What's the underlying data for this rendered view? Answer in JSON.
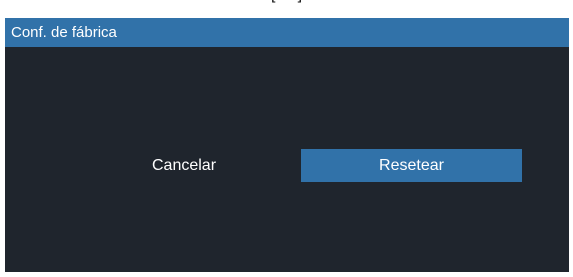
{
  "top_strip": {
    "text": "[ ... ]"
  },
  "dialog": {
    "title": "Conf. de fábrica",
    "buttons": {
      "cancel_label": "Cancelar",
      "reset_label": "Resetear"
    },
    "colors": {
      "titlebar": "#3172a9",
      "body": "#1f252d",
      "selected_button": "#3172a9",
      "text": "#ffffff"
    }
  }
}
